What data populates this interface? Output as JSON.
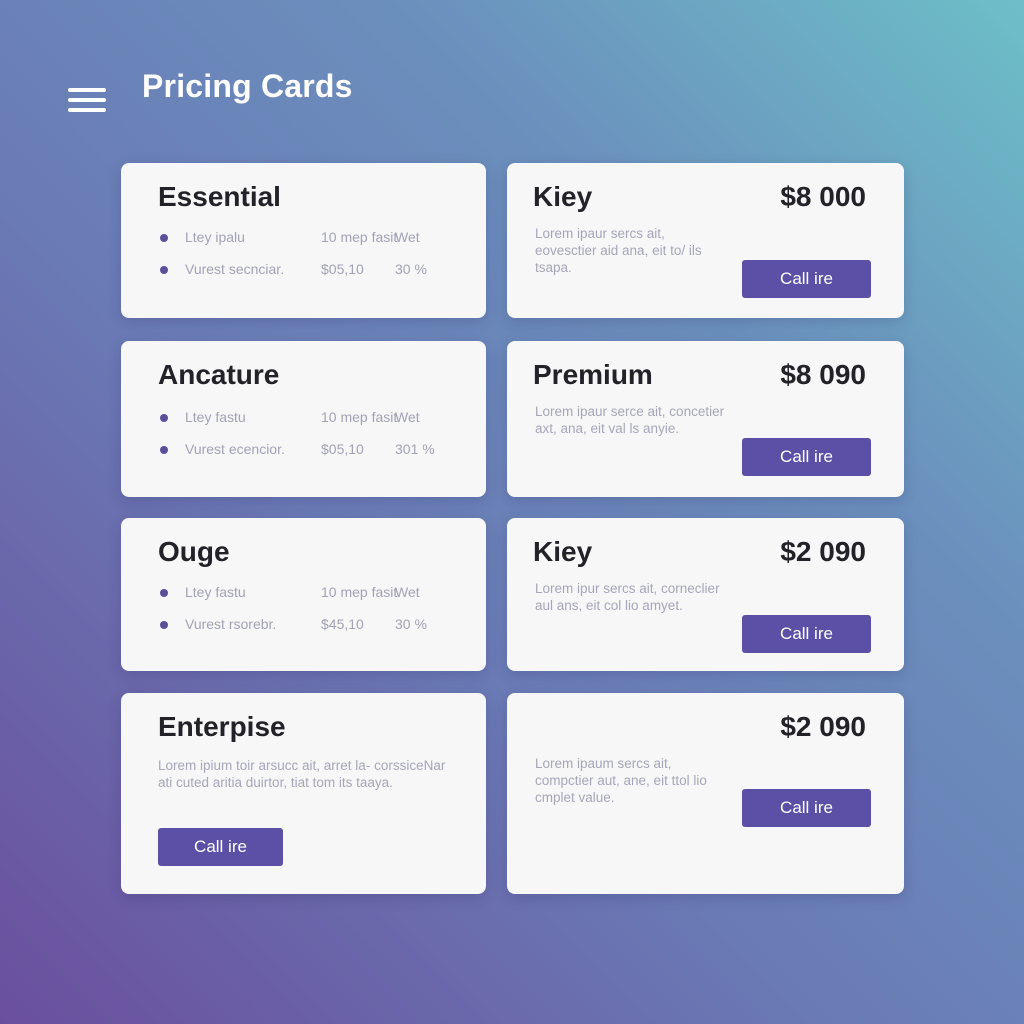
{
  "header": {
    "title": "Pricing Cards"
  },
  "cards_left": [
    {
      "title": "Essential",
      "features": [
        {
          "label": "Ltey ipalu",
          "value": "10 mep fasit",
          "extra": "Wet"
        },
        {
          "label": "Vurest secnciar.",
          "value": "$05,10",
          "extra": "30 %"
        }
      ]
    },
    {
      "title": "Ancature",
      "features": [
        {
          "label": "Ltey fastu",
          "value": "10 mep fasit",
          "extra": "Wet"
        },
        {
          "label": "Vurest ecencior.",
          "value": "$05,10",
          "extra": "301 %"
        }
      ]
    },
    {
      "title": "Ouge",
      "features": [
        {
          "label": "Ltey fastu",
          "value": "10 mep fasit",
          "extra": "Wet"
        },
        {
          "label": "Vurest rsorebr.",
          "value": "$45,10",
          "extra": "30 %"
        }
      ]
    },
    {
      "title": "Enterpise",
      "description": "Lorem ipium toir arsucc ait, arret la- corssiceNar ati cuted aritia duirtor, tiat tom its taaya.",
      "button_label": "Call ire"
    }
  ],
  "cards_right": [
    {
      "title": "Kiey",
      "price": "$8 000",
      "description": "Lorem ipaur sercs ait, eovesctier aid ana, eit to/ ils tsapa.",
      "button_label": "Call ire"
    },
    {
      "title": "Premium",
      "price": "$8 090",
      "description": "Lorem ipaur serce ait, concetier axt, ana, eit val ls anyie.",
      "button_label": "Call ire"
    },
    {
      "title": "Kiey",
      "price": "$2 090",
      "description": "Lorem ipur sercs ait, corneclier aul ans, eit col lio amyet.",
      "button_label": "Call ire"
    },
    {
      "title": "",
      "price": "$2 090",
      "description": "Lorem ipaum sercs ait, compctier aut, ane, eit ttol lio cmplet value.",
      "button_label": "Call ire"
    }
  ],
  "colors": {
    "accent": "#5b4fa6",
    "card_bg": "#f7f7f8",
    "title_text": "#222228",
    "muted_text": "#a2a2b4"
  },
  "icons": {
    "menu": "hamburger-menu-icon",
    "bullet": "bullet-dot-icon"
  }
}
